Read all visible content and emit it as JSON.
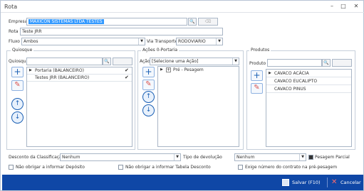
{
  "window": {
    "title": "Rota"
  },
  "form": {
    "empresa_label": "Empresa",
    "empresa_value": "MAXICON SISTEMAS LTDA TESTES",
    "rota_label": "Rota",
    "rota_value": "Teste JRR",
    "fluxo_label": "Fluxo",
    "fluxo_value": "Ambos",
    "via_label": "Via Transporte",
    "via_value": "RODOVIARIO"
  },
  "quiosque": {
    "group_title": "Quiosque",
    "search_label": "Quiosque",
    "items": [
      {
        "label": "Portaria (BALANCEIRO)",
        "checked": true
      },
      {
        "label": "Testes JRR (BALANCEIRO)",
        "checked": true
      }
    ]
  },
  "acoes": {
    "group_title": "Ações 0-Portaria",
    "action_label": "Ação",
    "action_value": "[Selecione uma Ação]",
    "items": [
      {
        "label": "Pré - Pesagem"
      }
    ]
  },
  "produtos": {
    "group_title": "Produtos",
    "search_label": "Produto",
    "items": [
      {
        "label": "CAVACO ACÁCIA"
      },
      {
        "label": "CAVACO EUCALIPTO"
      },
      {
        "label": "CAVACO PINUS"
      }
    ]
  },
  "bottom": {
    "desconto_label": "Desconto da Classificação",
    "desconto_value": "Nenhum",
    "tipo_label": "Tipo de devolução",
    "tipo_value": "Nenhum",
    "pesagem_parcial_label": "Pesagem Parcial",
    "nao_obrigar_deposito": "Não obrigar a informar Depósito",
    "nao_obrigar_tabela": "Não obrigar a informar Tabela Desconto",
    "exige_contrato": "Exige número do contrato na pré-pesagem"
  },
  "footer": {
    "save_label": "Salvar (F10)",
    "cancel_label": "Cancelar"
  },
  "colors": {
    "footer": "#0f47a6",
    "selection": "#3399ff",
    "accent": "#1a5fb4",
    "delete": "#d9534f"
  }
}
